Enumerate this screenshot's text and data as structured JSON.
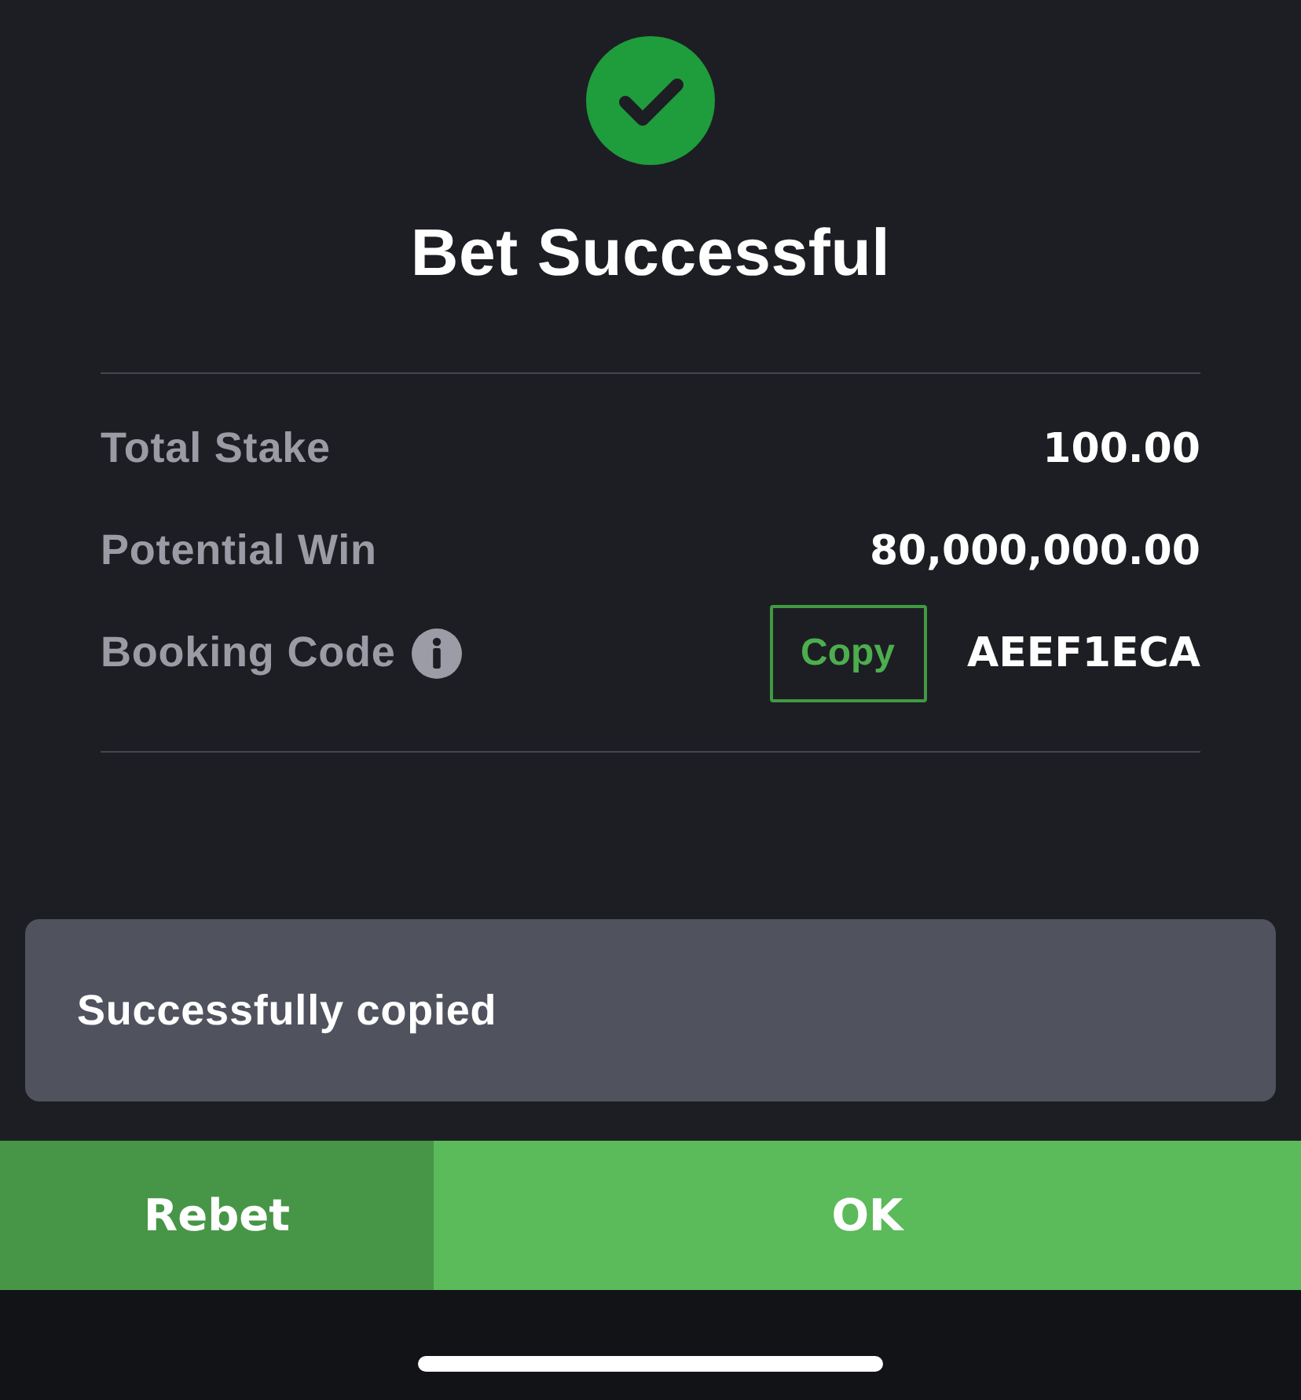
{
  "title": "Bet Successful",
  "summary": [
    {
      "label": "Total Stake",
      "value": "100.00",
      "info": false
    },
    {
      "label": "Potential Win",
      "value": "80,000,000.00",
      "info": false
    },
    {
      "label": "Booking Code",
      "info": true,
      "copy_button": "Copy",
      "value": "AEEF1ECA"
    }
  ],
  "toast": {
    "message": "Successfully copied"
  },
  "actions": [
    {
      "label": "Rebet",
      "kind": "secondary"
    },
    {
      "label": "OK",
      "kind": "primary"
    }
  ]
}
